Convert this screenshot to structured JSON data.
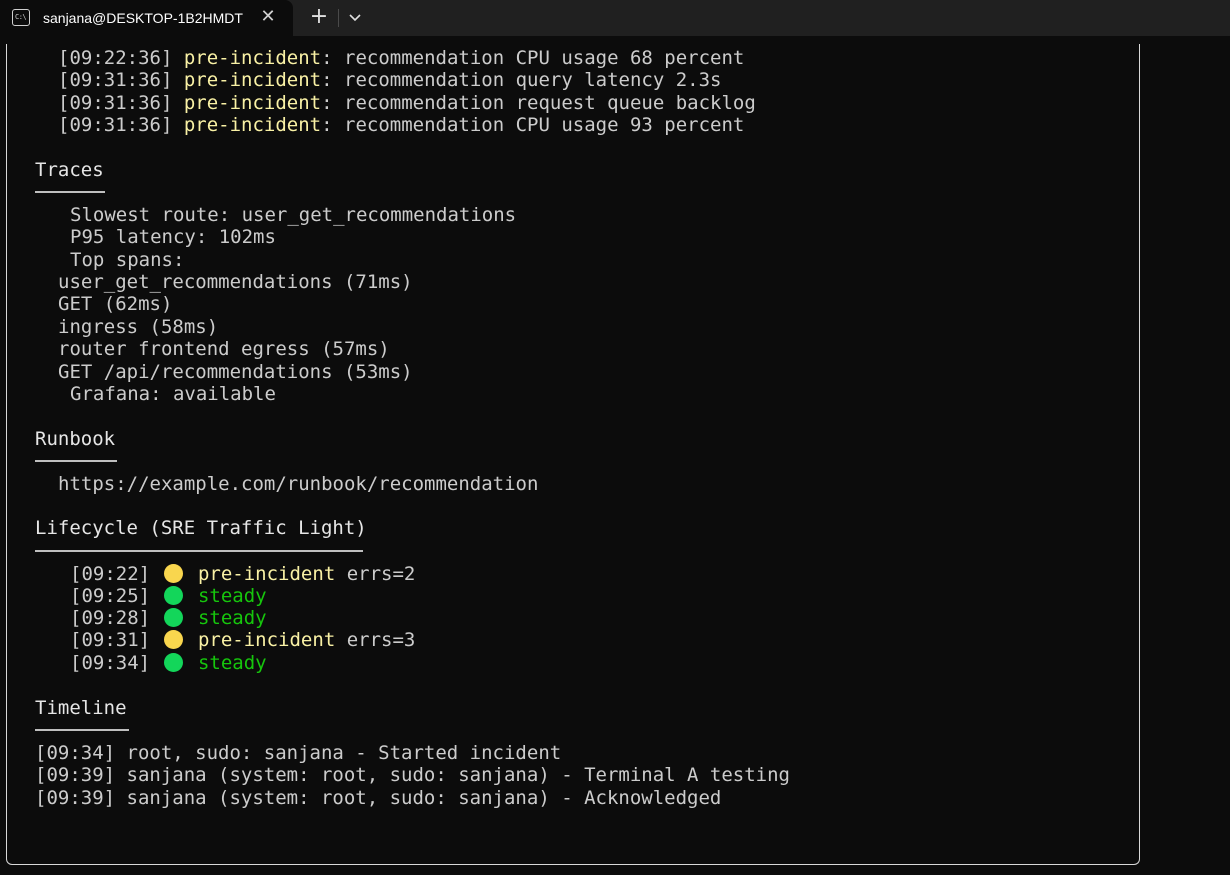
{
  "window": {
    "tab_title": "sanjana@DESKTOP-1B2HMDT",
    "tab_icon": "terminal-icon",
    "icon_glyph": "C:\\",
    "close_glyph": "✕",
    "new_tab_glyph": "+",
    "dropdown_icon": "chevron-down-icon"
  },
  "log_lines": [
    {
      "ts": "[09:22:36]",
      "tag": "pre-incident",
      "msg": ": recommendation CPU usage 68 percent"
    },
    {
      "ts": "[09:31:36]",
      "tag": "pre-incident",
      "msg": ": recommendation query latency 2.3s"
    },
    {
      "ts": "[09:31:36]",
      "tag": "pre-incident",
      "msg": ": recommendation request queue backlog"
    },
    {
      "ts": "[09:31:36]",
      "tag": "pre-incident",
      "msg": ": recommendation CPU usage 93 percent"
    }
  ],
  "traces": {
    "heading": "Traces",
    "slowest_route": "Slowest route: user_get_recommendations",
    "p95": "P95 latency: 102ms",
    "top_spans_label": "Top spans:",
    "spans": [
      "user_get_recommendations (71ms)",
      "GET (62ms)",
      "ingress (58ms)",
      "router frontend egress (57ms)",
      "GET /api/recommendations (53ms)"
    ],
    "grafana": "Grafana: available"
  },
  "runbook": {
    "heading": "Runbook",
    "url": "https://example.com/runbook/recommendation"
  },
  "lifecycle": {
    "heading": "Lifecycle (SRE Traffic Light)",
    "entries": [
      {
        "ts": "[09:22]",
        "state": "pre-incident",
        "extra": " errs=2",
        "color": "#f9d64e"
      },
      {
        "ts": "[09:25]",
        "state": "steady",
        "extra": "",
        "color": "#13d65a"
      },
      {
        "ts": "[09:28]",
        "state": "steady",
        "extra": "",
        "color": "#13d65a"
      },
      {
        "ts": "[09:31]",
        "state": "pre-incident",
        "extra": " errs=3",
        "color": "#f9d64e"
      },
      {
        "ts": "[09:34]",
        "state": "steady",
        "extra": "",
        "color": "#13d65a"
      }
    ]
  },
  "timeline": {
    "heading": "Timeline",
    "entries": [
      "[09:34] root, sudo: sanjana - Started incident",
      "[09:39] sanjana (system: root, sudo: sanjana) - Terminal A testing",
      "[09:39] sanjana (system: root, sudo: sanjana) - Acknowledged"
    ]
  },
  "colors": {
    "background": "#0c0c0c",
    "text": "#cccccc",
    "tag_yellow": "#f9f1a5",
    "state_green": "#16c60c"
  }
}
